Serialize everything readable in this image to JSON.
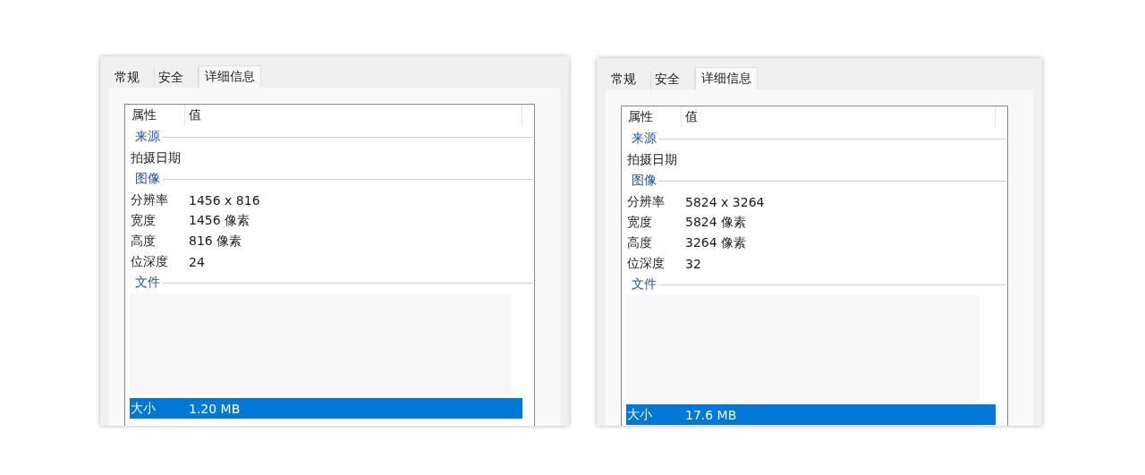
{
  "panels": [
    {
      "tabs": [
        {
          "label": "常规",
          "selected": false
        },
        {
          "label": "安全",
          "selected": false
        },
        {
          "label": "详细信息",
          "selected": true
        }
      ],
      "columns": [
        "属性",
        "值"
      ],
      "groups": [
        {
          "title": "来源",
          "rows": [
            {
              "name": "拍摄日期",
              "selected": false
            }
          ]
        },
        {
          "title": "图像",
          "rows": [
            {
              "name": "分辨率",
              "value": "1456 x 816",
              "selected": false
            },
            {
              "name": "宽度",
              "value": "1456 像素",
              "selected": false
            },
            {
              "name": "高度",
              "value": "816 像素",
              "selected": false
            },
            {
              "name": "位深度",
              "value": "24",
              "selected": false
            }
          ]
        },
        {
          "title": "文件",
          "rows": [
            {
              "name": "大小",
              "value": "1.20 MB",
              "selected": true
            }
          ]
        }
      ]
    },
    {
      "tabs": [
        {
          "label": "常规",
          "selected": false
        },
        {
          "label": "安全",
          "selected": false
        },
        {
          "label": "详细信息",
          "selected": true
        }
      ],
      "columns": [
        "属性",
        "值"
      ],
      "groups": [
        {
          "title": "来源",
          "rows": [
            {
              "name": "拍摄日期",
              "selected": false
            }
          ]
        },
        {
          "title": "图像",
          "rows": [
            {
              "name": "分辨率",
              "value": "5824 x 3264",
              "selected": false
            },
            {
              "name": "宽度",
              "value": "5824 像素",
              "selected": false
            },
            {
              "name": "高度",
              "value": "3264 像素",
              "selected": false
            },
            {
              "name": "位深度",
              "value": "32",
              "selected": false
            }
          ]
        },
        {
          "title": "文件",
          "rows": [
            {
              "name": "大小",
              "value": "17.6 MB",
              "selected": true
            }
          ]
        }
      ]
    }
  ]
}
